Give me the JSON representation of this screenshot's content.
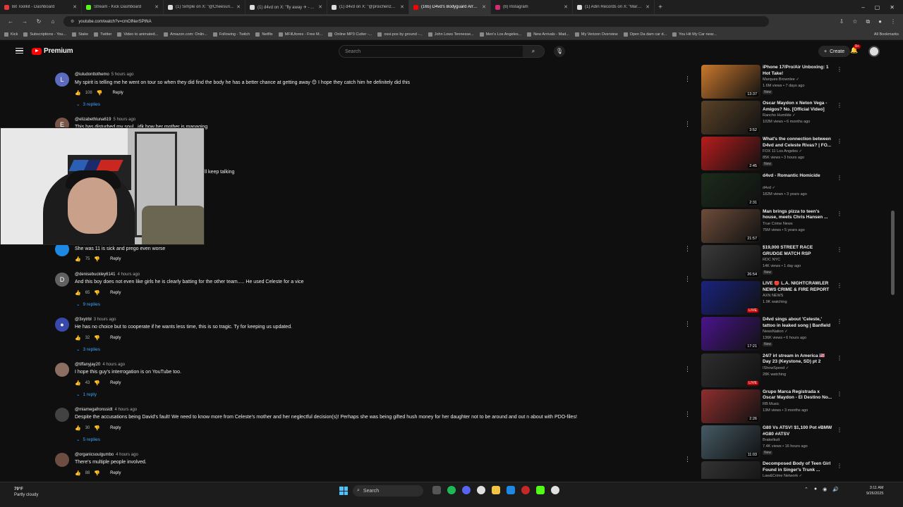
{
  "browser": {
    "tabs": [
      {
        "label": "Bit Toolkit - Dashboard",
        "color": "#e53935"
      },
      {
        "label": "Stream - Kick Dashboard",
        "color": "#53fc18"
      },
      {
        "label": "(1) Simple on X: \"@Cheesuri...",
        "color": "#dddddd"
      },
      {
        "label": "(1) d4vd on X: \"fly away ✈ - ...",
        "color": "#dddddd"
      },
      {
        "label": "(1) d4vd on X: \"@proichenzo ...",
        "color": "#dddddd"
      },
      {
        "label": "(165) D4vd's Bodyguard Arrest...",
        "color": "#ff0000",
        "active": true
      },
      {
        "label": "(8) Instagram",
        "color": "#d62976"
      },
      {
        "label": "(1) Adin Records on X: \"Marky...",
        "color": "#dddddd"
      }
    ],
    "new_tab": "+",
    "window_controls": [
      "–",
      "▢",
      "✕"
    ],
    "url": "youtube.com/watch?v=cmOlNerSPtNA",
    "bookmarks": [
      "Kick",
      "Subscriptions - You...",
      "Stake",
      "Twitter",
      "Video to animated...",
      "Amazon.com: Onlin...",
      "Following - Twitch",
      "Netflix",
      "MFilUtores - Free M...",
      "Online MP3 Cutter -...",
      "ossi-pos by ground -...",
      "John Lows Tennesse...",
      "Men's Los Angeles...",
      "New Arrivals - Mad...",
      "My Verizon Overview",
      "Open Da dam car d...",
      "You Hit My Car near..."
    ],
    "all_bookmarks": "All Bookmarks"
  },
  "youtube": {
    "logo_text": "Premium",
    "search_placeholder": "Search",
    "create_label": "Create",
    "notif_count": "9+"
  },
  "comments": [
    {
      "avatar": "L",
      "avatar_color": "#5c6bc0",
      "user": "@iuludonttothemo",
      "time": "5 hours ago",
      "text": "My spirit is telling me he went on tour so when they did find the body he has a better chance at getting away 😊 I hope they catch him he definitely did this",
      "likes": "108",
      "replies": "3 replies"
    },
    {
      "avatar": "E",
      "avatar_color": "#795548",
      "user": "@elizabethluna619",
      "time": "5 hours ago",
      "text": "This has disturbed my soul.. idk how her mother is managing",
      "likes": "",
      "replies": ""
    },
    {
      "avatar": "",
      "avatar_color": "#1e88e5",
      "user": "",
      "time": "",
      "text": "She was 11 is sick and prego even worse",
      "likes": "75",
      "replies": ""
    },
    {
      "avatar": "D",
      "avatar_color": "#616161",
      "user": "@denisebuckley6141",
      "time": "4 hours ago",
      "text": "And this boy does not even like girls he is clearly batting for the other team..... He used Celeste for a vice",
      "likes": "65",
      "replies": "9 replies"
    },
    {
      "avatar": "●",
      "avatar_color": "#3949ab",
      "user": "@3xytrbl",
      "time": "3 hours ago",
      "text": "He has no choice but to cooperate if he wants less time, this is so tragic. Ty for keeping us updated.",
      "likes": "32",
      "replies": "3 replies"
    },
    {
      "avatar": "",
      "avatar_color": "#8d6e63",
      "user": "@tiffanyjay20",
      "time": "4 hours ago",
      "text": "I hope this guy's interrogation is on YouTube too.",
      "likes": "43",
      "replies": "1 reply"
    },
    {
      "avatar": "",
      "avatar_color": "#424242",
      "user": "@miamegafronssidt",
      "time": "4 hours ago",
      "text": "Despite the accusations being David's fault! We need to know more from Celeste's mother and her neglectful decision(s)! Perhaps she was being gifted hush money for her daughter not to be around and out n about with PDO-files!",
      "likes": "30",
      "replies": "5 replies"
    },
    {
      "avatar": "",
      "avatar_color": "#6d4c41",
      "user": "@organicsoulgumbo",
      "time": "4 hours ago",
      "text": "There's multiple people involved.",
      "likes": "88",
      "replies": ""
    }
  ],
  "webcam": {
    "overlay_text": "ll keep talking"
  },
  "sidebar": [
    {
      "title": "iPhone 17/Pro/Air Unboxing: 1 Hot Take!",
      "channel": "Marques Brownlee ✓",
      "meta": "1.6M views • 7 days ago",
      "duration": "13:37",
      "badge": "New",
      "thumb": "#c9782e"
    },
    {
      "title": "Oscar Maydon x Neton Vega - Amigos? No. [Official Video]",
      "channel": "Rancho Humilde ✓",
      "meta": "102M views • 6 months ago",
      "duration": "3:52",
      "badge": "",
      "thumb": "#5a4228"
    },
    {
      "title": "What's the connection between D4vd and Celeste Rivas? | FO...",
      "channel": "FOX 11 Los Angeles ✓",
      "meta": "85K views • 3 hours ago",
      "duration": "2:45",
      "badge": "New",
      "thumb": "#b71c1c"
    },
    {
      "title": "d4vd - Romantic Homicide",
      "channel": "d4vd ✓",
      "meta": "182M views • 3 years ago",
      "duration": "2:31",
      "badge": "",
      "thumb": "#1b2b1b"
    },
    {
      "title": "Man brings pizza to teen's house, meets Chris Hansen ...",
      "channel": "True Crime News",
      "meta": "75M views • 5 years ago",
      "duration": "21:57",
      "badge": "",
      "thumb": "#6d4c3a"
    },
    {
      "title": "$19,000 STREET RACE GRUDGE MATCH RSP TRACKHAWK VS ...",
      "channel": "RDC NYC",
      "meta": "14K views • 1 day ago",
      "duration": "26:54",
      "badge": "New",
      "thumb": "#3a3a3a"
    },
    {
      "title": "LIVE 🔴 L.A. NIGHTCRAWLER NEWS CRIME & FIRE REPORT ...",
      "channel": "AXN NEWS",
      "meta": "1.9K watching",
      "duration": "LIVE",
      "badge": "",
      "thumb": "#1a237e"
    },
    {
      "title": "D4vd sings about 'Celeste,' tattoo in leaked song | Banfield",
      "channel": "NewsNation ✓",
      "meta": "136K views • 6 hours ago",
      "duration": "17:21",
      "badge": "New",
      "thumb": "#4a148c"
    },
    {
      "title": "24/7 irl stream in America 🇺🇸 Day 23 (Keystone, SD) pt 2",
      "channel": "IShowSpeed ✓",
      "meta": "28K watching",
      "duration": "LIVE",
      "badge": "",
      "thumb": "#2e2e2e"
    },
    {
      "title": "Grupo Marca Registrada x Oscar Maydon - El Destino No...",
      "channel": "RB Music",
      "meta": "13M views • 3 months ago",
      "duration": "2:26",
      "badge": "",
      "thumb": "#8e2f2f"
    },
    {
      "title": "G80 Vs ATSV! $1,100 Pot #BMW #G80 #ATSV",
      "channel": "Brakelkult",
      "meta": "7.4K views • 16 hours ago",
      "duration": "11:03",
      "badge": "New",
      "thumb": "#455a64"
    },
    {
      "title": "Decomposed Body of Teen Girl Found in Singer's Trunk ...",
      "channel": "Law&Crime Network ✓",
      "meta": "",
      "duration": "",
      "badge": "",
      "thumb": "#333333"
    }
  ],
  "taskbar": {
    "temp": "79°F",
    "weather": "Partly cloudy",
    "search": "Search",
    "time": "3:11 AM",
    "date": "9/26/2025"
  }
}
